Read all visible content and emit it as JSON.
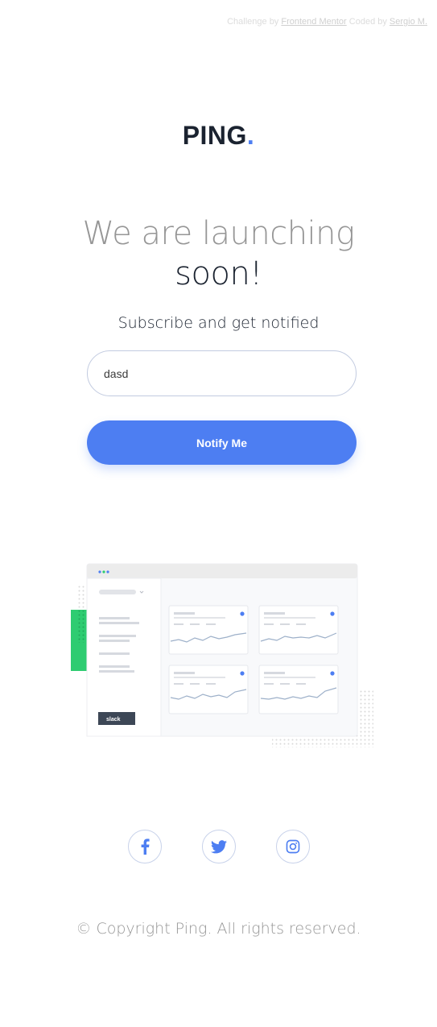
{
  "attribution": {
    "prefix": "Challenge by",
    "challenge_link": "Frontend Mentor",
    "coded_by": "Coded by",
    "author_link": "Sergio M."
  },
  "logo": {
    "text": "PING",
    "dot": "."
  },
  "headline": {
    "line1": "We are launching",
    "line2": "soon!"
  },
  "subhead": "Subscribe and get notified",
  "form": {
    "email_value": "dasd",
    "button_label": "Notify Me"
  },
  "illustration": {
    "slack_label": "slack"
  },
  "socials": [
    {
      "name": "facebook",
      "icon": "facebook-icon"
    },
    {
      "name": "twitter",
      "icon": "twitter-icon"
    },
    {
      "name": "instagram",
      "icon": "instagram-icon"
    }
  ],
  "footer": "© Copyright Ping. All rights reserved.",
  "colors": {
    "accent": "#4d7ef2",
    "dark": "#1b2330",
    "gray": "#969696",
    "green": "#2ecc71"
  }
}
